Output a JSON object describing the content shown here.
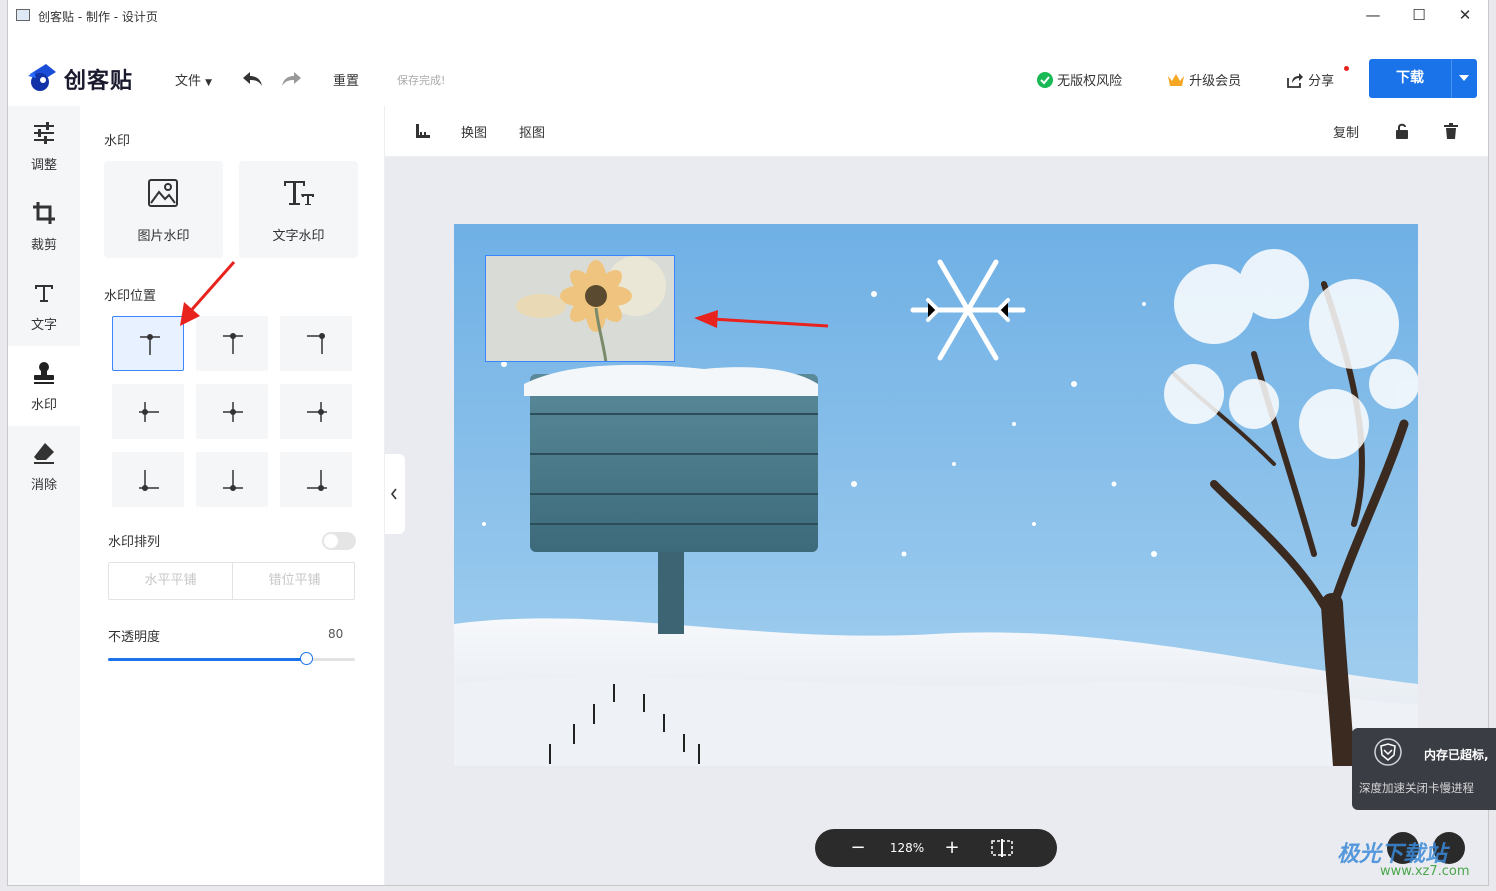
{
  "window": {
    "title": "创客贴 - 制作 - 设计页",
    "minimize": "—",
    "maximize": "☐",
    "close": "✕"
  },
  "header": {
    "logo_text": "创客贴",
    "file_menu": "文件",
    "reset": "重置",
    "save_status": "保存完成!",
    "no_copyright_risk": "无版权风险",
    "upgrade_member": "升级会员",
    "share": "分享",
    "download": "下载"
  },
  "left_nav": {
    "items": [
      {
        "label": "调整"
      },
      {
        "label": "裁剪"
      },
      {
        "label": "文字"
      },
      {
        "label": "水印"
      },
      {
        "label": "消除"
      }
    ],
    "active": "水印"
  },
  "panel": {
    "section_watermark": "水印",
    "image_watermark": "图片水印",
    "text_watermark": "文字水印",
    "section_position": "水印位置",
    "selected_position": "top-left",
    "section_arrangement": "水印排列",
    "arrangement_enabled": false,
    "tile_horizontal": "水平平铺",
    "tile_staggered": "错位平铺",
    "opacity_label": "不透明度",
    "opacity_value": "80",
    "opacity_fraction": 0.8
  },
  "toolbar": {
    "replace_image": "换图",
    "cutout": "抠图",
    "copy": "复制"
  },
  "zoom": {
    "minus": "−",
    "value": "128%",
    "plus": "+"
  },
  "toast": {
    "title": "内存已超标,",
    "subtitle": "深度加速关闭卡慢进程"
  },
  "site_watermark": {
    "brand": "极光下载站",
    "url": "www.xz7.com"
  },
  "colors": {
    "accent": "#1a73e8",
    "annotation": "#e8231e",
    "success": "#19b955",
    "crown": "#f5a623"
  }
}
